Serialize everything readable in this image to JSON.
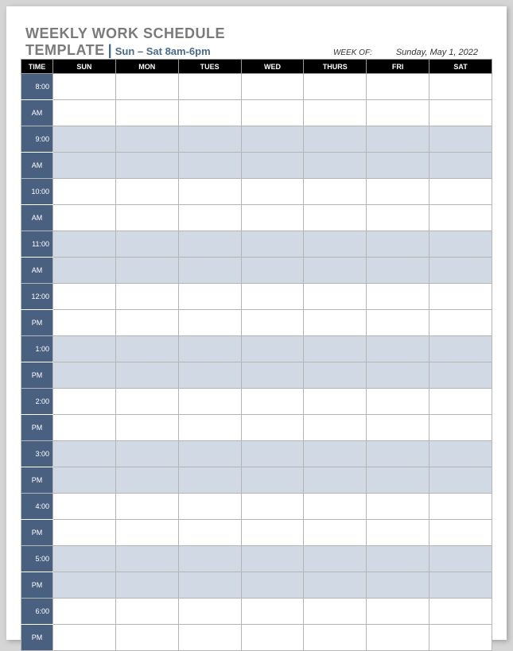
{
  "title": {
    "line1": "WEEKLY WORK SCHEDULE",
    "line2": "TEMPLATE",
    "subtitle": "Sun – Sat 8am-6pm"
  },
  "weekof": {
    "label": "WEEK OF:",
    "value": "Sunday, May 1, 2022"
  },
  "columns": [
    "TIME",
    "SUN",
    "MON",
    "TUES",
    "WED",
    "THURS",
    "FRI",
    "SAT"
  ],
  "slots": [
    {
      "time": "8:00",
      "ampm": "AM",
      "shade": false
    },
    {
      "time": "9:00",
      "ampm": "AM",
      "shade": true
    },
    {
      "time": "10:00",
      "ampm": "AM",
      "shade": false
    },
    {
      "time": "11:00",
      "ampm": "AM",
      "shade": true
    },
    {
      "time": "12:00",
      "ampm": "PM",
      "shade": false
    },
    {
      "time": "1:00",
      "ampm": "PM",
      "shade": true
    },
    {
      "time": "2:00",
      "ampm": "PM",
      "shade": false
    },
    {
      "time": "3:00",
      "ampm": "PM",
      "shade": true
    },
    {
      "time": "4:00",
      "ampm": "PM",
      "shade": false
    },
    {
      "time": "5:00",
      "ampm": "PM",
      "shade": true
    },
    {
      "time": "6:00",
      "ampm": "PM",
      "shade": false
    }
  ]
}
